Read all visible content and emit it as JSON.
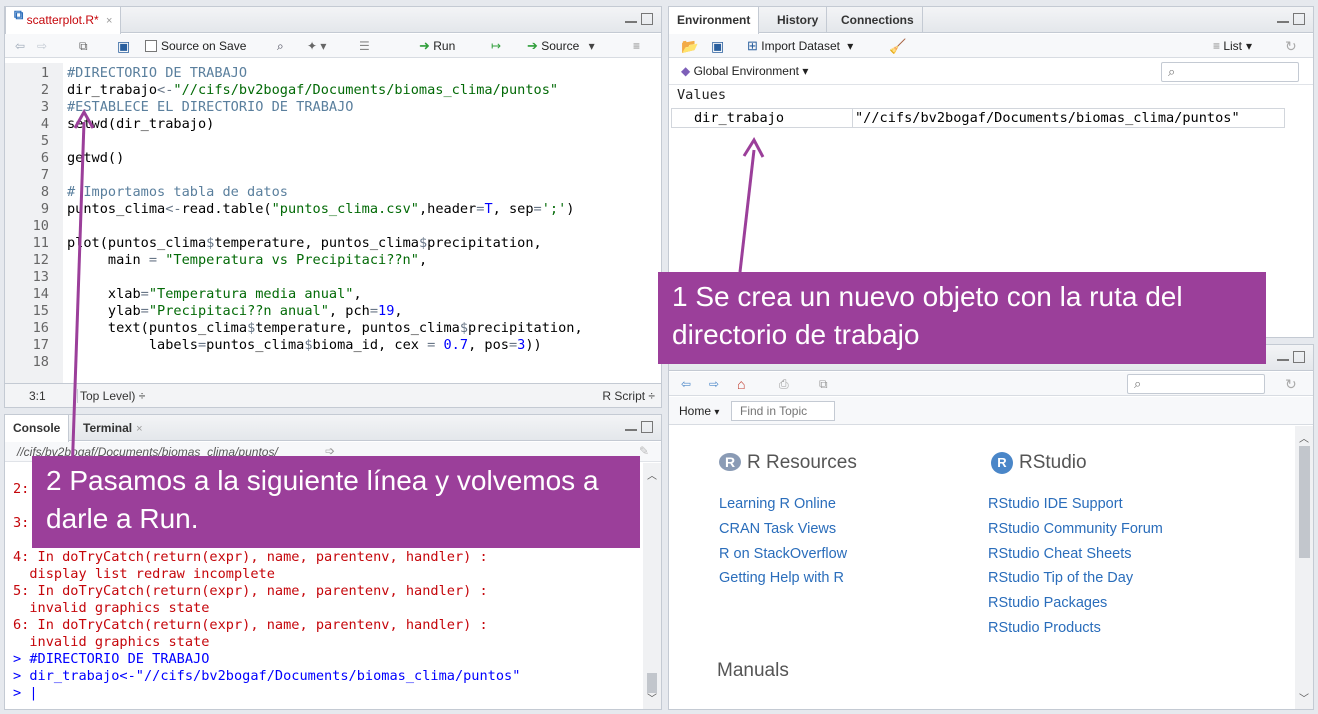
{
  "editor": {
    "tab": {
      "name": "scatterplot.R*",
      "close": "×"
    },
    "toolbar": {
      "source_on_save": "Source on Save",
      "run": "Run",
      "source": "Source"
    },
    "lines": [
      {
        "n": "1",
        "segs": [
          [
            "c-com",
            "#DIRECTORIO DE TRABAJO"
          ]
        ]
      },
      {
        "n": "2",
        "segs": [
          [
            "",
            "dir_trabajo"
          ],
          [
            "c-op",
            "<-"
          ],
          [
            "c-str",
            "\"//cifs/bv2bogaf/Documents/biomas_clima/puntos\""
          ]
        ]
      },
      {
        "n": "3",
        "segs": [
          [
            "c-com",
            "#ESTABLECE EL DIRECTORIO DE TRABAJO"
          ]
        ]
      },
      {
        "n": "4",
        "segs": [
          [
            "",
            "setwd(dir_trabajo)"
          ]
        ]
      },
      {
        "n": "5",
        "segs": []
      },
      {
        "n": "6",
        "segs": [
          [
            "",
            "getwd()"
          ]
        ]
      },
      {
        "n": "7",
        "segs": []
      },
      {
        "n": "8",
        "segs": [
          [
            "c-com",
            "# Importamos tabla de datos"
          ]
        ]
      },
      {
        "n": "9",
        "segs": [
          [
            "",
            "puntos_clima"
          ],
          [
            "c-op",
            "<-"
          ],
          [
            "",
            "read.table("
          ],
          [
            "c-str",
            "\"puntos_clima.csv\""
          ],
          [
            "",
            ",header"
          ],
          [
            "c-op",
            "="
          ],
          [
            "c-kw",
            "T"
          ],
          [
            "",
            ", sep"
          ],
          [
            "c-op",
            "="
          ],
          [
            "c-str",
            "';'"
          ],
          [
            "",
            ")"
          ]
        ]
      },
      {
        "n": "10",
        "segs": []
      },
      {
        "n": "11",
        "segs": [
          [
            "",
            "plot(puntos_clima"
          ],
          [
            "c-op",
            "$"
          ],
          [
            "",
            "temperature, puntos_clima"
          ],
          [
            "c-op",
            "$"
          ],
          [
            "",
            "precipitation,"
          ]
        ]
      },
      {
        "n": "12",
        "segs": [
          [
            "",
            "     main "
          ],
          [
            "c-op",
            "="
          ],
          [
            "",
            " "
          ],
          [
            "c-str",
            "\"Temperatura vs Precipitaci??n\""
          ],
          [
            "",
            ","
          ]
        ]
      },
      {
        "n": "13",
        "segs": []
      },
      {
        "n": "14",
        "segs": [
          [
            "",
            "     xlab"
          ],
          [
            "c-op",
            "="
          ],
          [
            "c-str",
            "\"Temperatura media anual\""
          ],
          [
            "",
            ","
          ]
        ]
      },
      {
        "n": "15",
        "segs": [
          [
            "",
            "     ylab"
          ],
          [
            "c-op",
            "="
          ],
          [
            "c-str",
            "\"Precipitaci??n anual\""
          ],
          [
            "",
            ", pch"
          ],
          [
            "c-op",
            "="
          ],
          [
            "c-kw",
            "19"
          ],
          [
            "",
            ","
          ]
        ]
      },
      {
        "n": "16",
        "segs": [
          [
            "",
            "     text(puntos_clima"
          ],
          [
            "c-op",
            "$"
          ],
          [
            "",
            "temperature, puntos_clima"
          ],
          [
            "c-op",
            "$"
          ],
          [
            "",
            "precipitation,"
          ]
        ]
      },
      {
        "n": "17",
        "segs": [
          [
            "",
            "          labels"
          ],
          [
            "c-op",
            "="
          ],
          [
            "",
            "puntos_clima"
          ],
          [
            "c-op",
            "$"
          ],
          [
            "",
            "bioma_id, cex "
          ],
          [
            "c-op",
            "="
          ],
          [
            "",
            " "
          ],
          [
            "c-kw",
            "0.7"
          ],
          [
            "",
            ", pos"
          ],
          [
            "c-op",
            "="
          ],
          [
            "c-kw",
            "3"
          ],
          [
            "",
            "))"
          ]
        ]
      },
      {
        "n": "18",
        "segs": []
      }
    ],
    "status": {
      "position": "3:1",
      "scope": "Top Level) ÷",
      "filetype": "R Script ÷"
    }
  },
  "console": {
    "tabs": {
      "console": "Console",
      "terminal": "Terminal",
      "close": "×"
    },
    "path": "//cifs/bv2bogaf/Documents/biomas_clima/puntos/",
    "hidden_lines": [
      {
        "text": "2:"
      },
      {
        "text": "3:"
      }
    ],
    "lines": [
      {
        "cls": "red",
        "text": "4: In doTryCatch(return(expr), name, parentenv, handler) :"
      },
      {
        "cls": "red",
        "text": "  display list redraw incomplete"
      },
      {
        "cls": "red",
        "text": "5: In doTryCatch(return(expr), name, parentenv, handler) :"
      },
      {
        "cls": "red",
        "text": "  invalid graphics state"
      },
      {
        "cls": "red",
        "text": "6: In doTryCatch(return(expr), name, parentenv, handler) :"
      },
      {
        "cls": "red",
        "text": "  invalid graphics state"
      },
      {
        "cls": "blue",
        "text": "> #DIRECTORIO DE TRABAJO"
      },
      {
        "cls": "blue",
        "text": "> dir_trabajo<-\"//cifs/bv2bogaf/Documents/biomas_clima/puntos\""
      },
      {
        "cls": "blue",
        "text": "> |"
      }
    ]
  },
  "environment": {
    "tabs": {
      "environment": "Environment",
      "history": "History",
      "connections": "Connections"
    },
    "toolbar": {
      "import": "Import Dataset",
      "list": "List"
    },
    "scope": "Global Environment",
    "section": "Values",
    "var_name": "dir_trabajo",
    "var_value": "\"//cifs/bv2bogaf/Documents/biomas_clima/puntos\""
  },
  "help": {
    "home": "Home",
    "find_placeholder": "Find in Topic",
    "r_resources": "R Resources",
    "rstudio": "RStudio",
    "r_links": [
      "Learning R Online",
      "CRAN Task Views",
      "R on StackOverflow",
      "Getting Help with R"
    ],
    "rstudio_links": [
      "RStudio IDE Support",
      "RStudio Community Forum",
      "RStudio Cheat Sheets",
      "RStudio Tip of the Day",
      "RStudio Packages",
      "RStudio Products"
    ],
    "manuals": "Manuals"
  },
  "annotations": {
    "one": "1 Se crea un nuevo objeto con la ruta del directorio de trabajo",
    "two": "2 Pasamos a la siguiente línea y volvemos a darle a Run."
  },
  "colors": {
    "annotation": "#9b3f9a",
    "link": "#2a6dbb",
    "error": "#c5060b",
    "command": "#0000ff"
  }
}
